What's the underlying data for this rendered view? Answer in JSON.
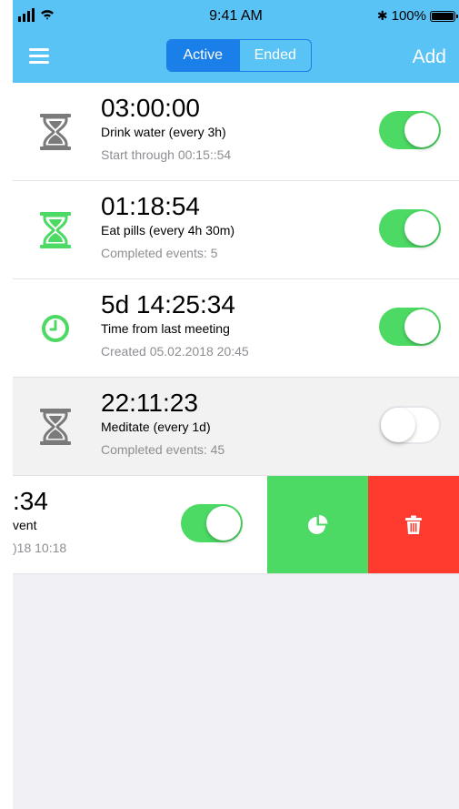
{
  "status_bar": {
    "time": "9:41 AM",
    "battery": "100%",
    "battery_level": 1.0
  },
  "nav": {
    "tabs": [
      "Active",
      "Ended"
    ],
    "selected_tab": "Active",
    "add_label": "Add"
  },
  "timers": [
    {
      "time": "03:00:00",
      "title": "Drink water (every 3h)",
      "subtitle": "Start through 00:15::54",
      "icon": "hourglass-icon",
      "icon_color": "#7a7a7a",
      "enabled": true
    },
    {
      "time": "01:18:54",
      "title": "Eat pills (every 4h 30m)",
      "subtitle": "Completed events: 5",
      "icon": "hourglass-icon",
      "icon_color": "#4cd964",
      "enabled": true
    },
    {
      "time": "5d 14:25:34",
      "title": "Time from last meeting",
      "subtitle": "Created 05.02.2018 20:45",
      "icon": "clock-icon",
      "icon_color": "#4cd964",
      "enabled": true
    },
    {
      "time": "22:11:23",
      "title": "Meditate (every 1d)",
      "subtitle": "Completed events: 45",
      "icon": "hourglass-icon",
      "icon_color": "#7a7a7a",
      "enabled": false
    }
  ],
  "swiped_row": {
    "time_fragment": ":34",
    "title_fragment": "vent",
    "subtitle_fragment": ")18 10:18",
    "enabled": true
  },
  "colors": {
    "nav_bg": "#5ac3f5",
    "segment_blue": "#1a7fe8",
    "toggle_on": "#4cd964",
    "delete_red": "#ff3b30"
  }
}
